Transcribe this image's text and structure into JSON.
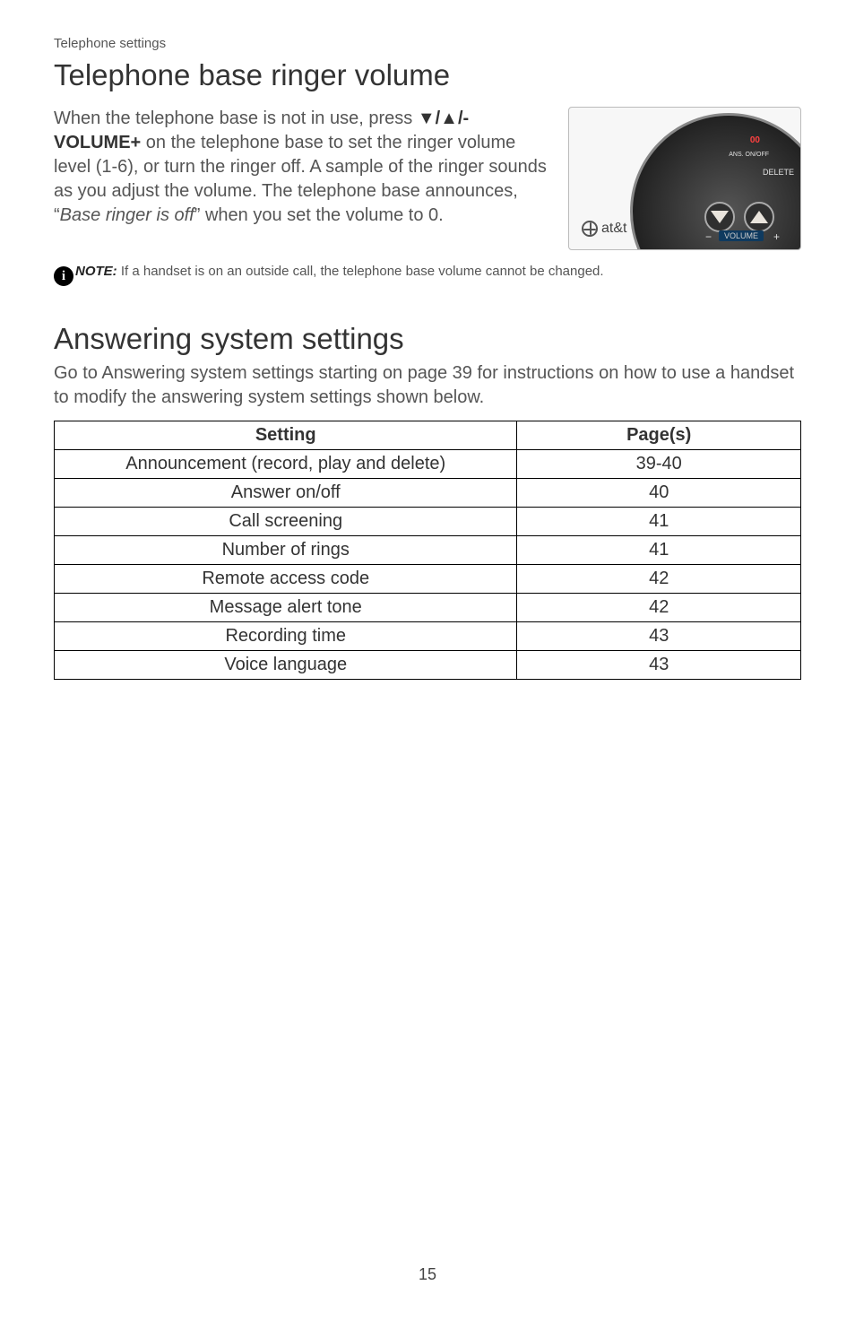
{
  "category": "Telephone settings",
  "section1": {
    "heading": "Telephone base ringer volume",
    "para_part1": "When the telephone base is not in use, press ",
    "volume_label": "/-VOLUME+",
    "para_part2": " on the telephone base to set the ringer volume level (1-6), or turn the ringer off. A sample of the ringer sounds as you adjust the volume. The telephone base announces, “",
    "italic_phrase": "Base ringer is off",
    "para_part3": "” when you set the volume to 0.",
    "device": {
      "brand": "at&t",
      "label_msg": "00",
      "label_ans": "ANS. ON/OFF",
      "label_delete": "DELETE",
      "label_minus": "−",
      "label_plus": "+",
      "label_volume": "VOLUME"
    },
    "note_prefix": "NOTE:",
    "note_text": " If a handset is on an outside call, the telephone base volume cannot be changed."
  },
  "section2": {
    "heading": "Answering system settings",
    "intro": "Go to Answering system settings starting on page 39 for instructions on how to use a handset to modify the answering system settings shown below.",
    "table": {
      "headers": {
        "setting": "Setting",
        "pages": "Page(s)"
      },
      "rows": [
        {
          "setting": "Announcement (record, play and delete)",
          "pages": "39-40"
        },
        {
          "setting": "Answer on/off",
          "pages": "40"
        },
        {
          "setting": "Call screening",
          "pages": "41"
        },
        {
          "setting": "Number of rings",
          "pages": "41"
        },
        {
          "setting": "Remote access code",
          "pages": "42"
        },
        {
          "setting": "Message alert tone",
          "pages": "42"
        },
        {
          "setting": "Recording time",
          "pages": "43"
        },
        {
          "setting": "Voice language",
          "pages": "43"
        }
      ]
    }
  },
  "page_number": "15"
}
